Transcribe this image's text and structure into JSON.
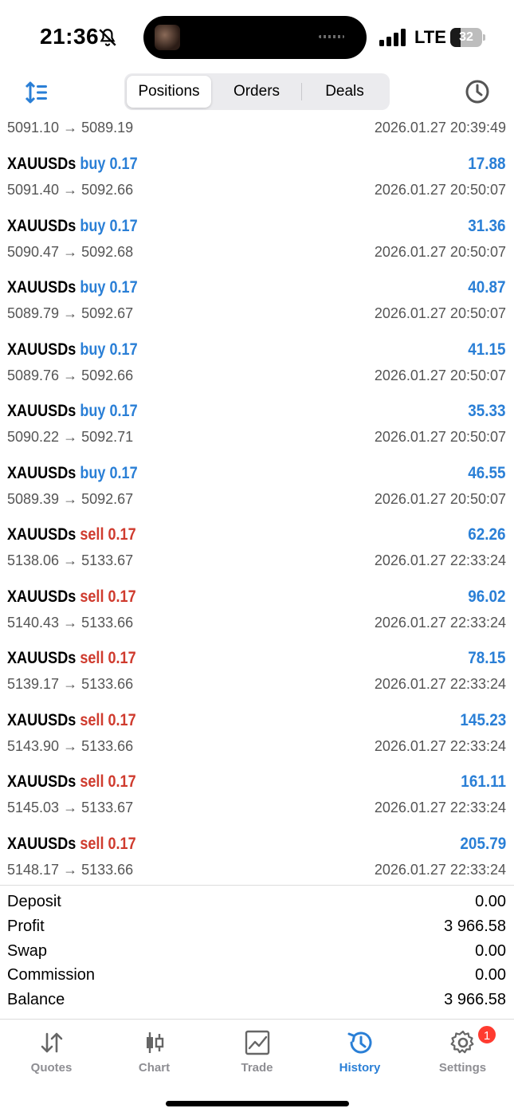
{
  "status_bar": {
    "time": "21:36",
    "network": "LTE",
    "battery": "32",
    "battery_fraction": 0.32
  },
  "toolbar": {
    "tabs": [
      {
        "label": "Positions",
        "active": true
      },
      {
        "label": "Orders",
        "active": false
      },
      {
        "label": "Deals",
        "active": false
      }
    ]
  },
  "deals": [
    {
      "symbol": "",
      "side": "",
      "volume": "",
      "profit": "",
      "prices": "5091.10 → 5089.19",
      "time": "2026.01.27 20:39:49"
    },
    {
      "symbol": "XAUUSDs",
      "side": "buy",
      "volume": "0.17",
      "profit": "17.88",
      "prices": "5091.40 → 5092.66",
      "time": "2026.01.27 20:50:07"
    },
    {
      "symbol": "XAUUSDs",
      "side": "buy",
      "volume": "0.17",
      "profit": "31.36",
      "prices": "5090.47 → 5092.68",
      "time": "2026.01.27 20:50:07"
    },
    {
      "symbol": "XAUUSDs",
      "side": "buy",
      "volume": "0.17",
      "profit": "40.87",
      "prices": "5089.79 → 5092.67",
      "time": "2026.01.27 20:50:07"
    },
    {
      "symbol": "XAUUSDs",
      "side": "buy",
      "volume": "0.17",
      "profit": "41.15",
      "prices": "5089.76 → 5092.66",
      "time": "2026.01.27 20:50:07"
    },
    {
      "symbol": "XAUUSDs",
      "side": "buy",
      "volume": "0.17",
      "profit": "35.33",
      "prices": "5090.22 → 5092.71",
      "time": "2026.01.27 20:50:07"
    },
    {
      "symbol": "XAUUSDs",
      "side": "buy",
      "volume": "0.17",
      "profit": "46.55",
      "prices": "5089.39 → 5092.67",
      "time": "2026.01.27 20:50:07"
    },
    {
      "symbol": "XAUUSDs",
      "side": "sell",
      "volume": "0.17",
      "profit": "62.26",
      "prices": "5138.06 → 5133.67",
      "time": "2026.01.27 22:33:24"
    },
    {
      "symbol": "XAUUSDs",
      "side": "sell",
      "volume": "0.17",
      "profit": "96.02",
      "prices": "5140.43 → 5133.66",
      "time": "2026.01.27 22:33:24"
    },
    {
      "symbol": "XAUUSDs",
      "side": "sell",
      "volume": "0.17",
      "profit": "78.15",
      "prices": "5139.17 → 5133.66",
      "time": "2026.01.27 22:33:24"
    },
    {
      "symbol": "XAUUSDs",
      "side": "sell",
      "volume": "0.17",
      "profit": "145.23",
      "prices": "5143.90 → 5133.66",
      "time": "2026.01.27 22:33:24"
    },
    {
      "symbol": "XAUUSDs",
      "side": "sell",
      "volume": "0.17",
      "profit": "161.11",
      "prices": "5145.03 → 5133.67",
      "time": "2026.01.27 22:33:24"
    },
    {
      "symbol": "XAUUSDs",
      "side": "sell",
      "volume": "0.17",
      "profit": "205.79",
      "prices": "5148.17 → 5133.66",
      "time": "2026.01.27 22:33:24"
    }
  ],
  "summary": [
    {
      "label": "Deposit",
      "value": "0.00"
    },
    {
      "label": "Profit",
      "value": "3 966.58"
    },
    {
      "label": "Swap",
      "value": "0.00"
    },
    {
      "label": "Commission",
      "value": "0.00"
    },
    {
      "label": "Balance",
      "value": "3 966.58"
    }
  ],
  "tabbar": {
    "tabs": [
      {
        "label": "Quotes",
        "icon": "quotes-arrows-icon",
        "active": false
      },
      {
        "label": "Chart",
        "icon": "candlestick-icon",
        "active": false
      },
      {
        "label": "Trade",
        "icon": "trade-chart-icon",
        "active": false
      },
      {
        "label": "History",
        "icon": "history-clock-icon",
        "active": true
      },
      {
        "label": "Settings",
        "icon": "gear-icon",
        "active": false,
        "badge": "1"
      }
    ]
  },
  "colors": {
    "accent": "#2a7fd6",
    "sell": "#cf3b2e",
    "badge": "#ff3b30"
  }
}
